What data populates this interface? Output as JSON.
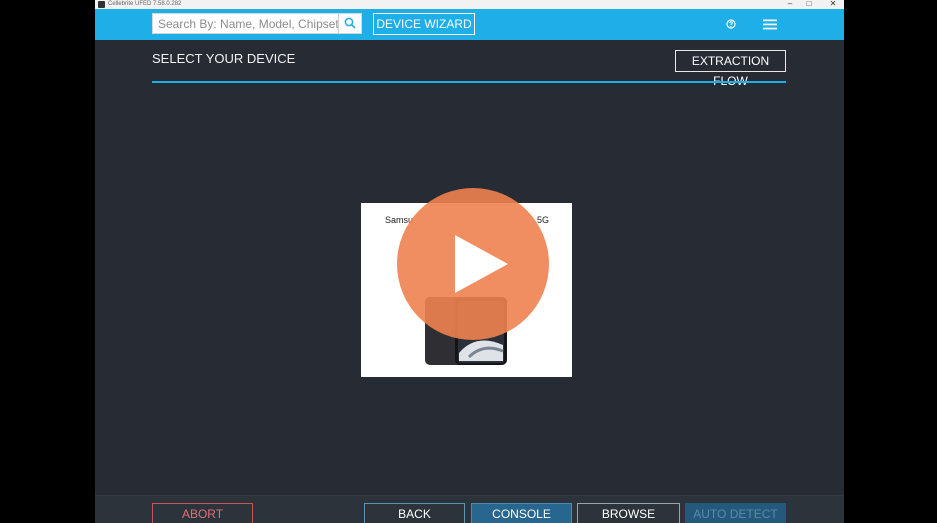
{
  "window": {
    "title": "Cellebrite UFED 7.58.0.282",
    "minimize_glyph": "–",
    "maximize_glyph": "□",
    "close_glyph": "✕"
  },
  "toolbar": {
    "search_placeholder": "Search By: Name, Model, Chipset, ...",
    "search_icon": "search-icon",
    "wizard_label": "DEVICE WIZARD",
    "help_icon": "help-circle-icon",
    "menu_icon": "hamburger-menu-icon"
  },
  "main": {
    "title": "SELECT YOUR DEVICE",
    "extraction_flow_label": "EXTRACTION FLOW",
    "device_card": {
      "label_left": "Samsu",
      "label_right": "5G"
    },
    "video_overlay_icon": "play-icon"
  },
  "footer": {
    "abort_label": "ABORT",
    "back_label": "BACK",
    "console_label": "CONSOLE",
    "browse_label": "BROWSE DEVICES",
    "auto_detect_label": "AUTO DETECT"
  },
  "colors": {
    "accent": "#1eaee8",
    "background": "#272c34",
    "abort": "#c4545a",
    "play_overlay": "#f08250"
  }
}
